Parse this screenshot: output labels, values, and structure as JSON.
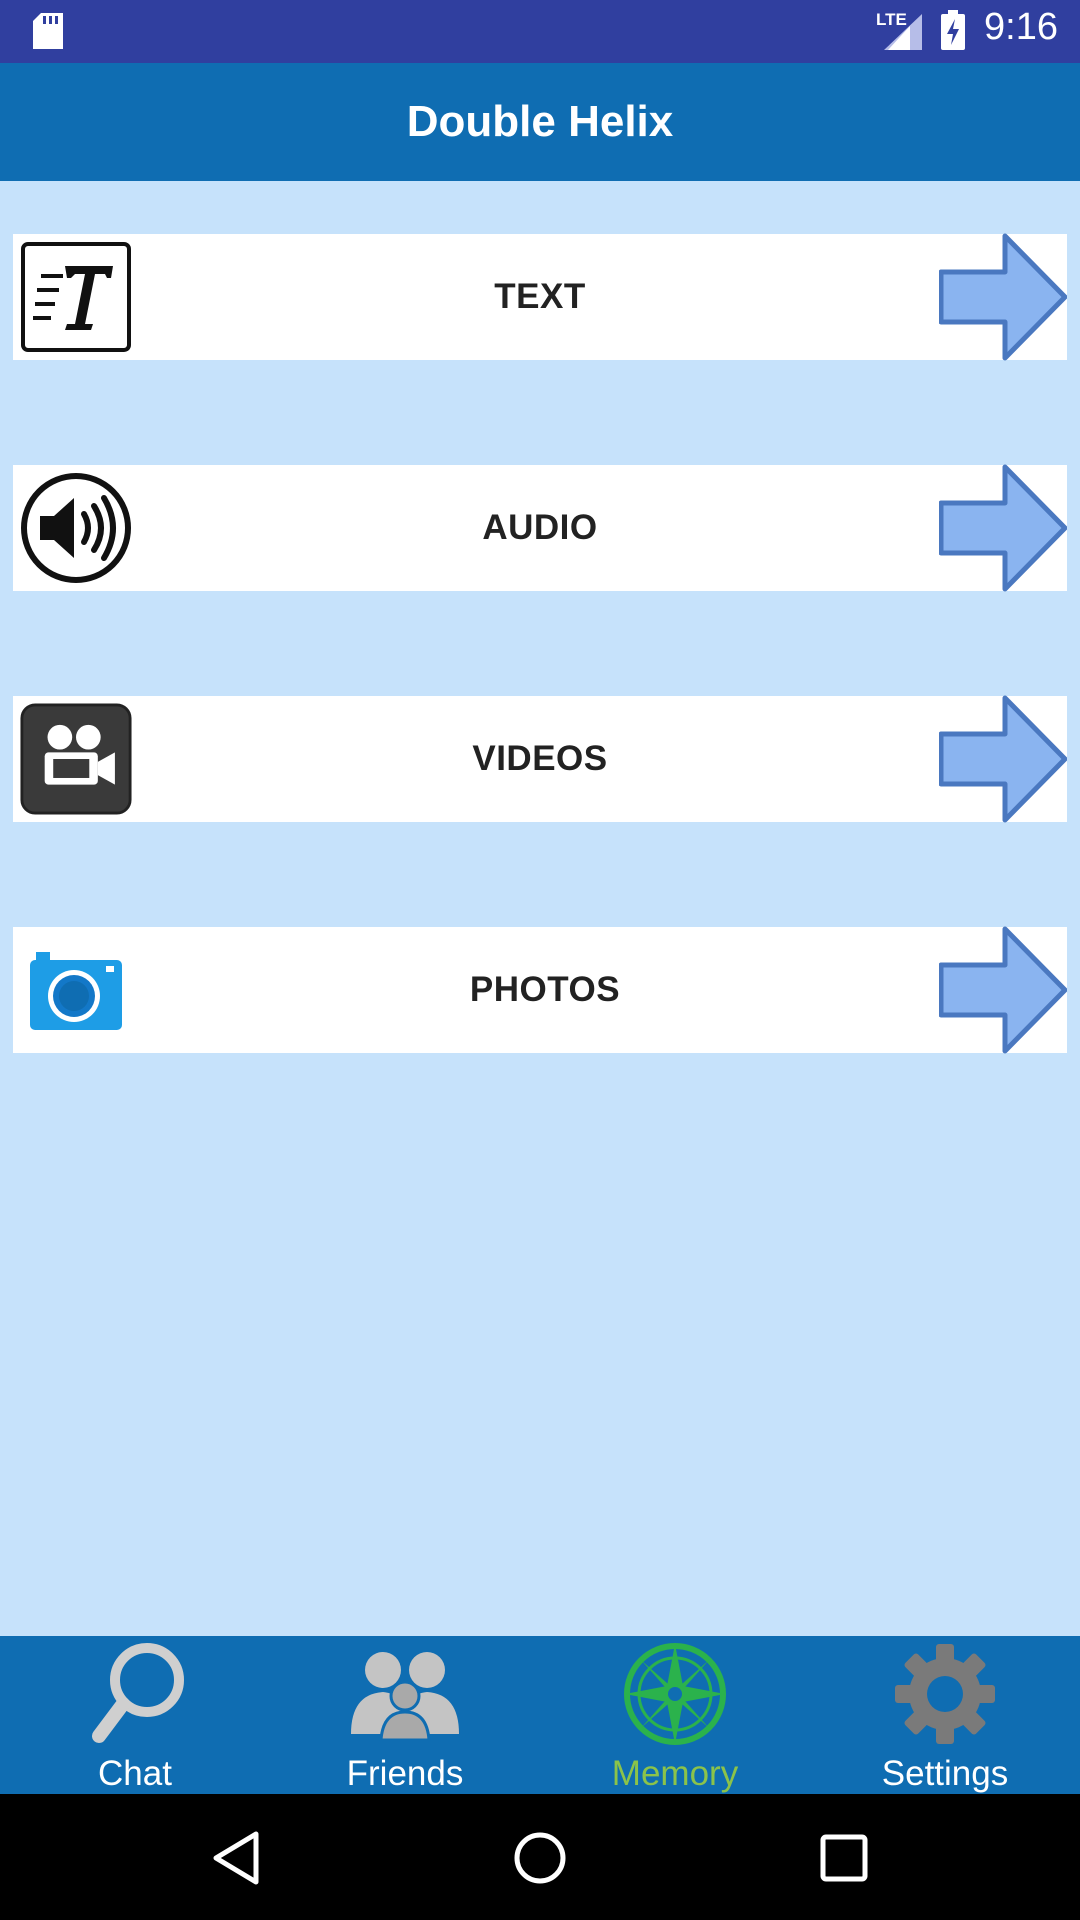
{
  "status_bar": {
    "time": "9:16",
    "network": "LTE",
    "icons": [
      "sd-card-icon",
      "signal-icon",
      "battery-charging-icon"
    ]
  },
  "app_bar": {
    "title": "Double Helix"
  },
  "menu": {
    "items": [
      {
        "label": "TEXT",
        "icon": "text-icon"
      },
      {
        "label": "AUDIO",
        "icon": "speaker-icon"
      },
      {
        "label": "VIDEOS",
        "icon": "video-camera-icon"
      },
      {
        "label": "PHOTOS",
        "icon": "photo-camera-icon"
      }
    ],
    "arrow_icon": "arrow-right-icon"
  },
  "bottom_nav": {
    "active": "Memory",
    "tabs": [
      {
        "label": "Chat",
        "icon": "search-icon"
      },
      {
        "label": "Friends",
        "icon": "friends-icon"
      },
      {
        "label": "Memory",
        "icon": "compass-icon"
      },
      {
        "label": "Settings",
        "icon": "gear-icon"
      }
    ]
  },
  "colors": {
    "status_bar": "#303f9f",
    "app_bar": "#0f6db2",
    "background": "#c6e2fb",
    "arrow_fill": "#8ab4f0",
    "arrow_stroke": "#4a78c0",
    "active_tab": "#8bc34a",
    "nav_bar": "#000000"
  }
}
